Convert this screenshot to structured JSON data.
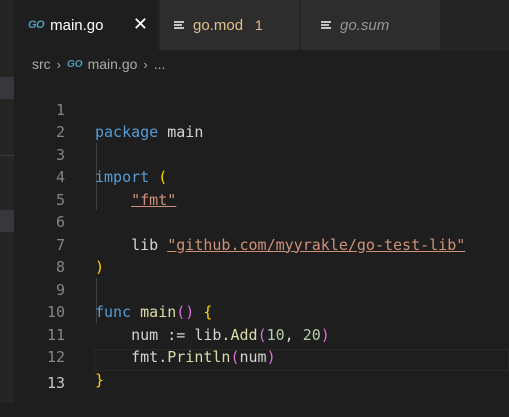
{
  "tabs": [
    {
      "icon": "go-file-icon",
      "glyph": "GO",
      "label": "main.go",
      "active": true,
      "close": "✕"
    },
    {
      "icon": "mod-file-icon",
      "label": "go.mod",
      "badge": "1"
    },
    {
      "icon": "sum-file-icon",
      "label": "go.sum"
    }
  ],
  "breadcrumb": {
    "folder": "src",
    "sep": "›",
    "go_glyph": "GO",
    "file": "main.go",
    "ellipsis": "..."
  },
  "editor": {
    "line_numbers": [
      "1",
      "2",
      "3",
      "4",
      "5",
      "6",
      "7",
      "8",
      "9",
      "10",
      "11",
      "12",
      "13"
    ],
    "active_line": 13,
    "tokens": {
      "l1_kw": "package",
      "l1_name": " main",
      "l3_kw": "import",
      "l3_paren": "(",
      "l4_str": "\"fmt\"",
      "l6_alias": "lib ",
      "l6_str": "\"github.com/myyrakle/go-test-lib\"",
      "l7_paren": ")",
      "l9_kw": "func",
      "l9_fn": "main",
      "l9_parens": "()",
      "l9_brace": "{",
      "l10_var": "num := lib.",
      "l10_fn": "Add",
      "l10_open": "(",
      "l10_n1": "10",
      "l10_comma": ", ",
      "l10_n2": "20",
      "l10_close": ")",
      "l11_pkg": "fmt.",
      "l11_fn": "Println",
      "l11_open": "(",
      "l11_arg": "num",
      "l11_close": ")",
      "l12_brace": "}"
    }
  },
  "colors": {
    "background": "#1e1e1e",
    "keyword": "#569cd6",
    "function": "#dcdcaa",
    "string": "#ce9178",
    "number": "#b5cea8",
    "bracket": "#ffd700",
    "modified": "#e2c08d"
  }
}
